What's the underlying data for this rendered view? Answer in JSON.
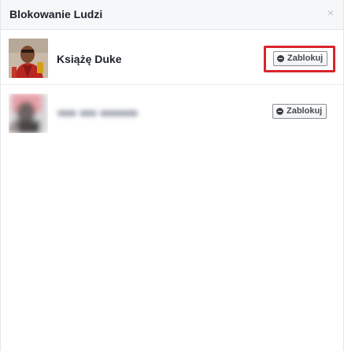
{
  "dialog": {
    "title": "Blokowanie Ludzi",
    "close_glyph": "×"
  },
  "people": [
    {
      "name": "Książę Duke",
      "button_label": "Zablokuj",
      "highlighted": true
    },
    {
      "name": "",
      "name_obscured": true,
      "button_label": "Zablokuj"
    }
  ],
  "colors": {
    "highlight": "#d9262c",
    "header_bg": "#f6f7f9"
  },
  "icons": [
    "close-icon",
    "minus-circle-icon"
  ]
}
